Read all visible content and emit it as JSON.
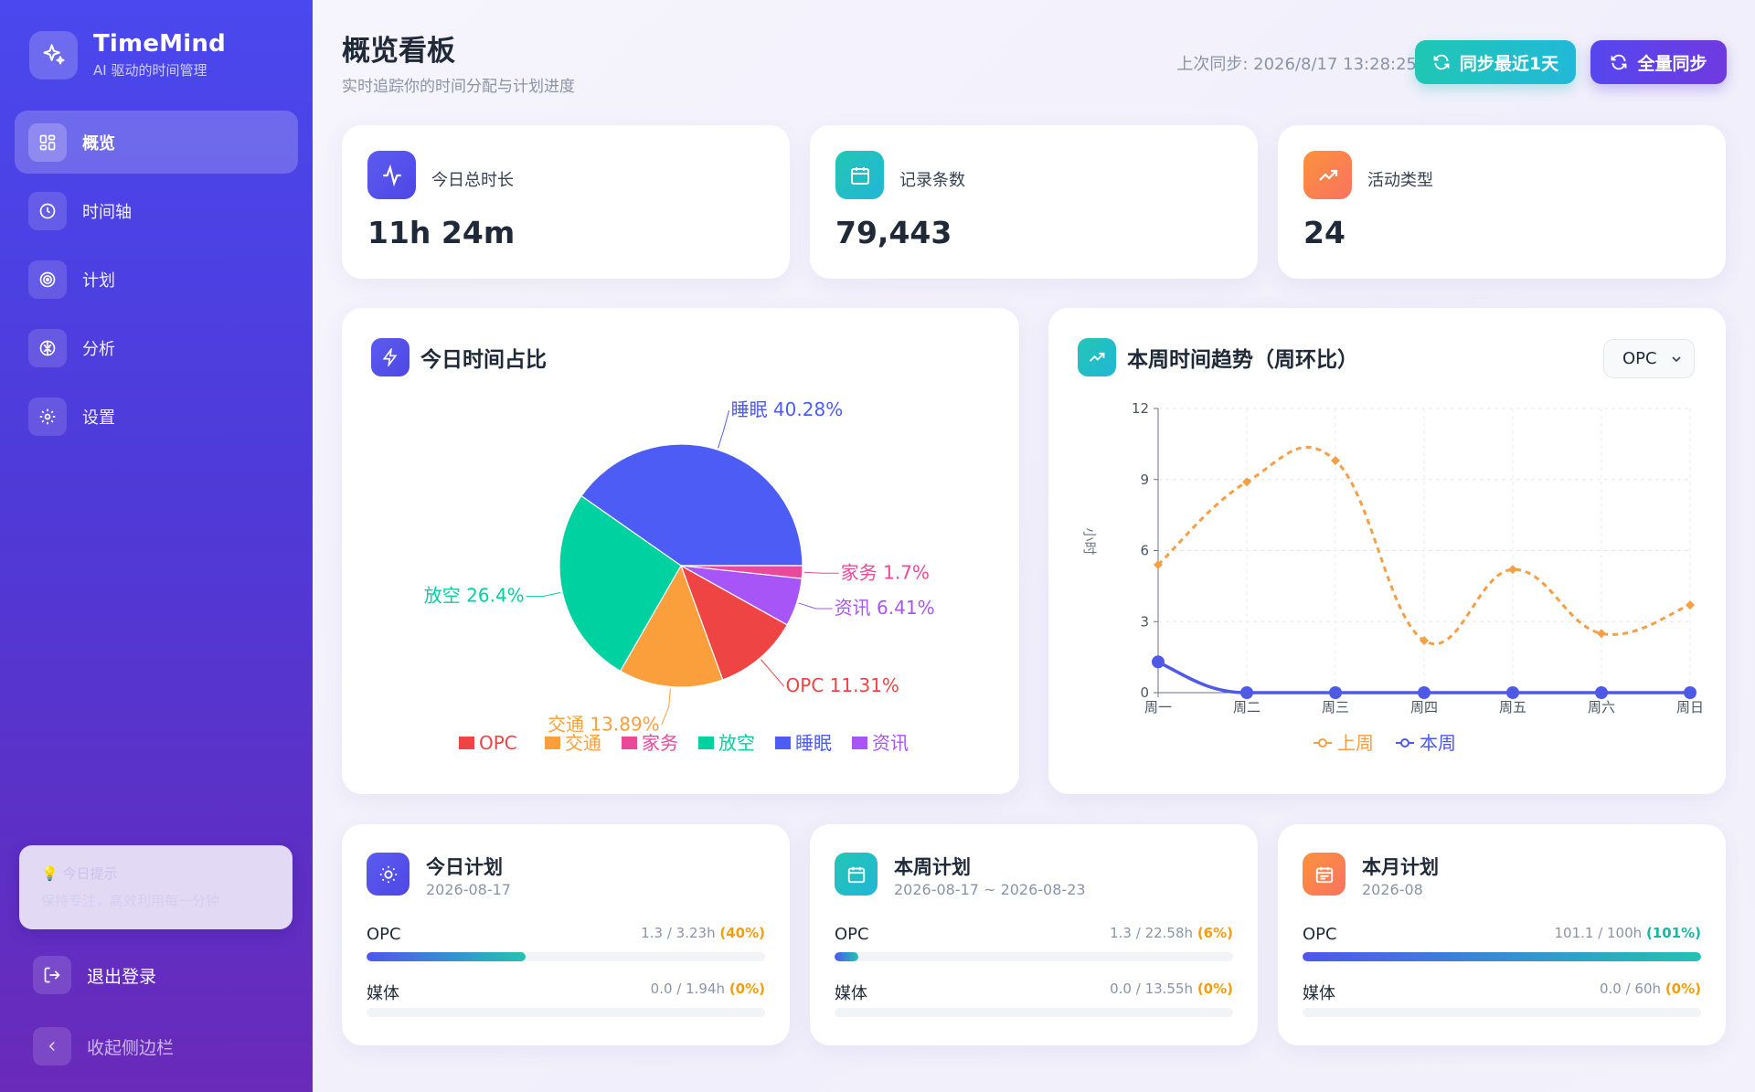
{
  "app": {
    "title": "TimeMind",
    "subtitle": "AI 驱动的时间管理"
  },
  "sidebar": {
    "items": [
      {
        "label": "概览",
        "icon": "grid-icon",
        "active": true
      },
      {
        "label": "时间轴",
        "icon": "clock-icon",
        "active": false
      },
      {
        "label": "计划",
        "icon": "target-icon",
        "active": false
      },
      {
        "label": "分析",
        "icon": "brain-icon",
        "active": false
      },
      {
        "label": "设置",
        "icon": "gear-icon",
        "active": false
      }
    ],
    "tip": {
      "title": "💡 今日提示",
      "text": "保持专注，高效利用每一分钟"
    },
    "logout_label": "退出登录",
    "collapse_label": "收起侧边栏"
  },
  "header": {
    "title": "概览看板",
    "subtitle": "实时追踪你的时间分配与计划进度",
    "last_sync": "上次同步: 2026/8/17 13:28:25",
    "sync_recent_label": "同步最近1天",
    "sync_full_label": "全量同步"
  },
  "stats": [
    {
      "label": "今日总时长",
      "value": "11h 24m",
      "icon": "activity-icon"
    },
    {
      "label": "记录条数",
      "value": "79,443",
      "icon": "calendar-icon"
    },
    {
      "label": "活动类型",
      "value": "24",
      "icon": "trending-up-icon"
    }
  ],
  "pie_card": {
    "title": "今日时间占比",
    "icon": "zap-icon"
  },
  "trend_card": {
    "title": "本周时间趋势（周环比）",
    "icon": "trending-up-icon",
    "select_value": "OPC"
  },
  "colors": {
    "OPC": "#ef4444",
    "交通": "#fb9f3c",
    "家务": "#ec4899",
    "放空": "#00d1a0",
    "睡眠": "#4c5cf5",
    "资讯": "#a855f7",
    "上周": "#f59f47",
    "本周": "#4e5ae6"
  },
  "chart_data": [
    {
      "type": "pie",
      "slices": [
        {
          "label": "睡眠",
          "value": 40.28,
          "text": "睡眠 40.28%"
        },
        {
          "label": "家务",
          "value": 1.7,
          "text": "家务 1.7%"
        },
        {
          "label": "资讯",
          "value": 6.41,
          "text": "资讯 6.41%"
        },
        {
          "label": "OPC",
          "value": 11.31,
          "text": "OPC 11.31%"
        },
        {
          "label": "交通",
          "value": 13.89,
          "text": "交通 13.89%"
        },
        {
          "label": "放空",
          "value": 26.4,
          "text": "放空 26.4%"
        }
      ],
      "legend": [
        "OPC",
        "交通",
        "家务",
        "放空",
        "睡眠",
        "资讯"
      ],
      "legend_position": "bottom"
    },
    {
      "type": "line",
      "x": [
        "周一",
        "周二",
        "周三",
        "周四",
        "周五",
        "周六",
        "周日"
      ],
      "series": [
        {
          "name": "上周",
          "values": [
            5.4,
            8.9,
            9.8,
            2.2,
            5.2,
            2.5,
            3.7
          ]
        },
        {
          "name": "本周",
          "values": [
            1.3,
            0,
            0,
            0,
            0,
            0,
            0
          ]
        }
      ],
      "ylabel": "小时",
      "yticks": [
        0,
        3,
        6,
        9,
        12
      ],
      "ylim": [
        0,
        12
      ],
      "grid": true,
      "legend_position": "bottom"
    }
  ],
  "plans": [
    {
      "title": "今日计划",
      "date": "2026-08-17",
      "icon": "sun-icon",
      "rows": [
        {
          "name": "OPC",
          "value": "1.3 / 3.23h",
          "pct": "(40%)",
          "progress": 0.4
        },
        {
          "name": "媒体",
          "value": "0.0 / 1.94h",
          "pct": "(0%)",
          "progress": 0
        }
      ]
    },
    {
      "title": "本周计划",
      "date": "2026-08-17 ~ 2026-08-23",
      "icon": "calendar-week-icon",
      "rows": [
        {
          "name": "OPC",
          "value": "1.3 / 22.58h",
          "pct": "(6%)",
          "progress": 0.06
        },
        {
          "name": "媒体",
          "value": "0.0 / 13.55h",
          "pct": "(0%)",
          "progress": 0
        }
      ]
    },
    {
      "title": "本月计划",
      "date": "2026-08",
      "icon": "calendar-month-icon",
      "rows": [
        {
          "name": "OPC",
          "value": "101.1 / 100h",
          "pct": "(101%)",
          "progress": 1.0
        },
        {
          "name": "媒体",
          "value": "0.0 / 60h",
          "pct": "(0%)",
          "progress": 0
        }
      ]
    }
  ]
}
